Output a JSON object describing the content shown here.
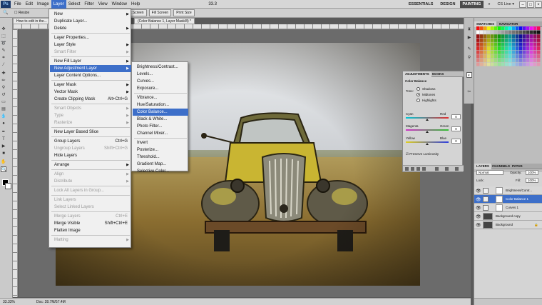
{
  "app": {
    "logo": "Ps",
    "window_title": "How to edit in the...",
    "doc_tab_rest": "(Color Balance 1, Layer Mask/8) *"
  },
  "menubar": {
    "items": [
      "File",
      "Edit",
      "Image",
      "Layer",
      "Select",
      "Filter",
      "View",
      "Window",
      "Help"
    ],
    "active": "Layer",
    "zoom": "33.3",
    "workspaces": [
      "ESSENTIALS",
      "DESIGN",
      "PAINTING"
    ],
    "active_workspace": "PAINTING",
    "more": "»",
    "cs_live": "CS Live ▾",
    "window_buttons": [
      "–",
      "□",
      "×"
    ]
  },
  "options_bar": {
    "resize_label": "Resize",
    "buttons": [
      "Actual Pixels",
      "Fit Screen",
      "Fill Screen",
      "Print Size"
    ]
  },
  "layer_menu": [
    {
      "label": "New",
      "arrow": "▶"
    },
    {
      "label": "Duplicate Layer..."
    },
    {
      "label": "Delete",
      "arrow": "▶"
    },
    {
      "sep": true
    },
    {
      "label": "Layer Properties..."
    },
    {
      "label": "Layer Style",
      "arrow": "▶"
    },
    {
      "label": "Smart Filter",
      "disabled": true,
      "arrow": "▶"
    },
    {
      "sep": true
    },
    {
      "label": "New Fill Layer",
      "arrow": "▶"
    },
    {
      "label": "New Adjustment Layer",
      "arrow": "▶",
      "highlight": true
    },
    {
      "label": "Layer Content Options..."
    },
    {
      "sep": true
    },
    {
      "label": "Layer Mask",
      "arrow": "▶"
    },
    {
      "label": "Vector Mask",
      "arrow": "▶"
    },
    {
      "label": "Create Clipping Mask",
      "shortcut": "Alt+Ctrl+G"
    },
    {
      "sep": true
    },
    {
      "label": "Smart Objects",
      "disabled": true,
      "arrow": "▶"
    },
    {
      "label": "Type",
      "disabled": true,
      "arrow": "▶"
    },
    {
      "label": "Rasterize",
      "disabled": true,
      "arrow": "▶"
    },
    {
      "sep": true
    },
    {
      "label": "New Layer Based Slice"
    },
    {
      "sep": true
    },
    {
      "label": "Group Layers",
      "shortcut": "Ctrl+G"
    },
    {
      "label": "Ungroup Layers",
      "shortcut": "Shift+Ctrl+G",
      "disabled": true
    },
    {
      "label": "Hide Layers"
    },
    {
      "sep": true
    },
    {
      "label": "Arrange",
      "arrow": "▶"
    },
    {
      "sep": true
    },
    {
      "label": "Align",
      "disabled": true,
      "arrow": "▶"
    },
    {
      "label": "Distribute",
      "disabled": true,
      "arrow": "▶"
    },
    {
      "sep": true
    },
    {
      "label": "Lock All Layers in Group...",
      "disabled": true
    },
    {
      "sep": true
    },
    {
      "label": "Link Layers",
      "disabled": true
    },
    {
      "label": "Select Linked Layers",
      "disabled": true
    },
    {
      "sep": true
    },
    {
      "label": "Merge Layers",
      "shortcut": "Ctrl+E",
      "disabled": true
    },
    {
      "label": "Merge Visible",
      "shortcut": "Shift+Ctrl+E"
    },
    {
      "label": "Flatten Image"
    },
    {
      "sep": true
    },
    {
      "label": "Matting",
      "disabled": true,
      "arrow": "▶"
    }
  ],
  "adjustment_submenu": [
    {
      "label": "Brightness/Contrast..."
    },
    {
      "label": "Levels..."
    },
    {
      "label": "Curves..."
    },
    {
      "label": "Exposure..."
    },
    {
      "sep": true
    },
    {
      "label": "Vibrance..."
    },
    {
      "label": "Hue/Saturation..."
    },
    {
      "label": "Color Balance...",
      "highlight": true
    },
    {
      "label": "Black & White..."
    },
    {
      "label": "Photo Filter..."
    },
    {
      "label": "Channel Mixer..."
    },
    {
      "sep": true
    },
    {
      "label": "Invert"
    },
    {
      "label": "Posterize..."
    },
    {
      "label": "Threshold..."
    },
    {
      "label": "Gradient Map..."
    },
    {
      "label": "Selective Color..."
    }
  ],
  "adjustments_panel": {
    "tabs": [
      "ADJUSTMENTS",
      "MASKS"
    ],
    "title": "Color Balance",
    "tone_label": "Tone:",
    "tones": [
      "Shadows",
      "Midtones",
      "Highlights"
    ],
    "selected_tone": "Midtones",
    "sliders": [
      {
        "left": "Cyan",
        "right": "Red",
        "value": "0",
        "level": 0.5,
        "colors": [
          "#00c8d8",
          "#e03030"
        ]
      },
      {
        "left": "Magenta",
        "right": "Green",
        "value": "0",
        "level": 0.5,
        "colors": [
          "#d030c8",
          "#30c030"
        ]
      },
      {
        "left": "Yellow",
        "right": "Blue",
        "value": "0",
        "level": 0.5,
        "colors": [
          "#e0d020",
          "#3040e0"
        ]
      }
    ],
    "preserve_luminosity": "Preserve Luminosity"
  },
  "swatches_panel": {
    "tabs": [
      "SWATCHES",
      "NAVIGATOR"
    ]
  },
  "layers_panel": {
    "tabs": [
      "LAYERS",
      "CHANNELS",
      "PATHS"
    ],
    "blend_mode": "Normal",
    "opacity_label": "Opacity:",
    "opacity": "100%",
    "lock_label": "Lock:",
    "fill_label": "Fill:",
    "fill": "100%",
    "layers": [
      {
        "name": "Brightness/Contr...",
        "type": "adjustment",
        "selected": false
      },
      {
        "name": "Color Balance 1",
        "type": "adjustment",
        "selected": true
      },
      {
        "name": "Curves 1",
        "type": "adjustment",
        "selected": false
      },
      {
        "name": "Background copy",
        "type": "image",
        "selected": false
      },
      {
        "name": "Background",
        "type": "image",
        "selected": false,
        "locked": true
      }
    ]
  },
  "status_bar": {
    "zoom": "33.33%",
    "doc_info": "Doc: 28.7M/57.4M"
  }
}
